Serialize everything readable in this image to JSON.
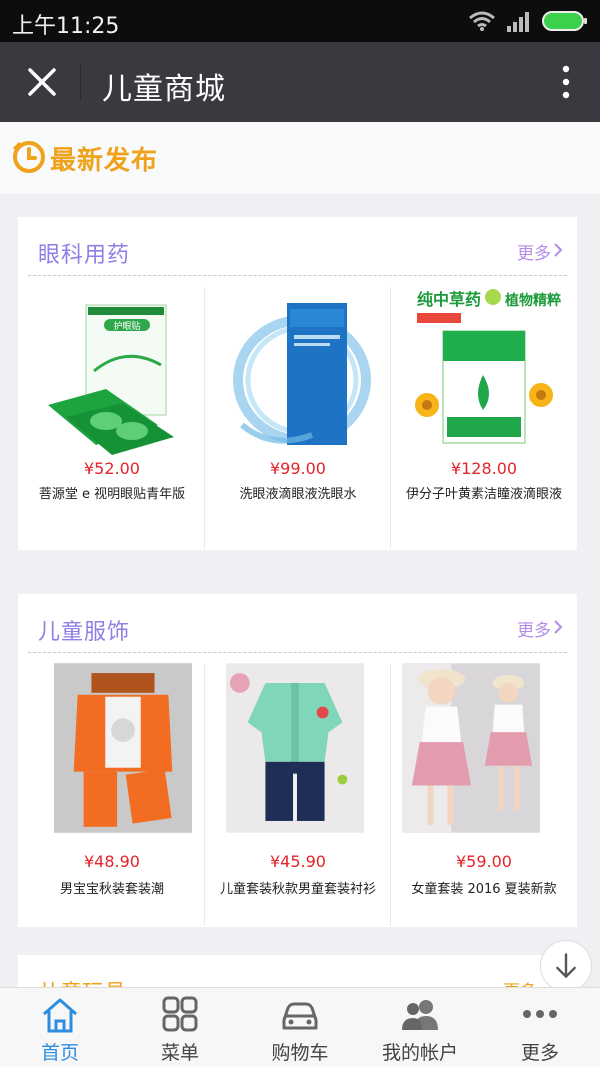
{
  "status_bar": {
    "time": "上午11:25"
  },
  "titlebar": {
    "title": "儿童商城"
  },
  "banner": {
    "label": "最新发布"
  },
  "sections": [
    {
      "name": "眼科用药",
      "more": "更多",
      "products": [
        {
          "price": "¥52.00",
          "name": "菩源堂 e 视明眼贴青年版",
          "image": "green-eye-patch-box",
          "img_text_a": "护眼贴",
          "img_text_b": ""
        },
        {
          "price": "¥99.00",
          "name": "洗眼液滴眼液洗眼水",
          "image": "blue-eye-wash-water-splash",
          "img_text_a": "",
          "img_text_b": ""
        },
        {
          "price": "¥128.00",
          "name": "伊分子叶黄素洁瞳液滴眼液",
          "image": "herbal-eye-drops-box-flowers",
          "img_text_a": "纯中草药",
          "img_text_b": "植物精粹"
        }
      ]
    },
    {
      "name": "儿童服饰",
      "more": "更多",
      "products": [
        {
          "price": "¥48.90",
          "name": "男宝宝秋装套装潮",
          "image": "orange-baby-outfit"
        },
        {
          "price": "¥45.90",
          "name": "儿童套装秋款男童套装衬衫",
          "image": "green-shirt-jeans-outfit"
        },
        {
          "price": "¥59.00",
          "name": "女童套装 2016 夏装新款",
          "image": "girls-pink-skirt-outfit"
        }
      ]
    }
  ],
  "partial_section": {
    "name": "儿童玩具",
    "more": "更多"
  },
  "tabs": [
    {
      "label": "首页",
      "icon": "home-icon",
      "active": true
    },
    {
      "label": "菜单",
      "icon": "grid-icon",
      "active": false
    },
    {
      "label": "购物车",
      "icon": "car-icon",
      "active": false
    },
    {
      "label": "我的帐户",
      "icon": "users-icon",
      "active": false
    },
    {
      "label": "更多",
      "icon": "dots-icon",
      "active": false
    }
  ],
  "colors": {
    "accent_orange": "#f0a21d",
    "price_red": "#e2242a",
    "tab_active": "#2d8ee0",
    "section_title": "#8f7ee6"
  }
}
